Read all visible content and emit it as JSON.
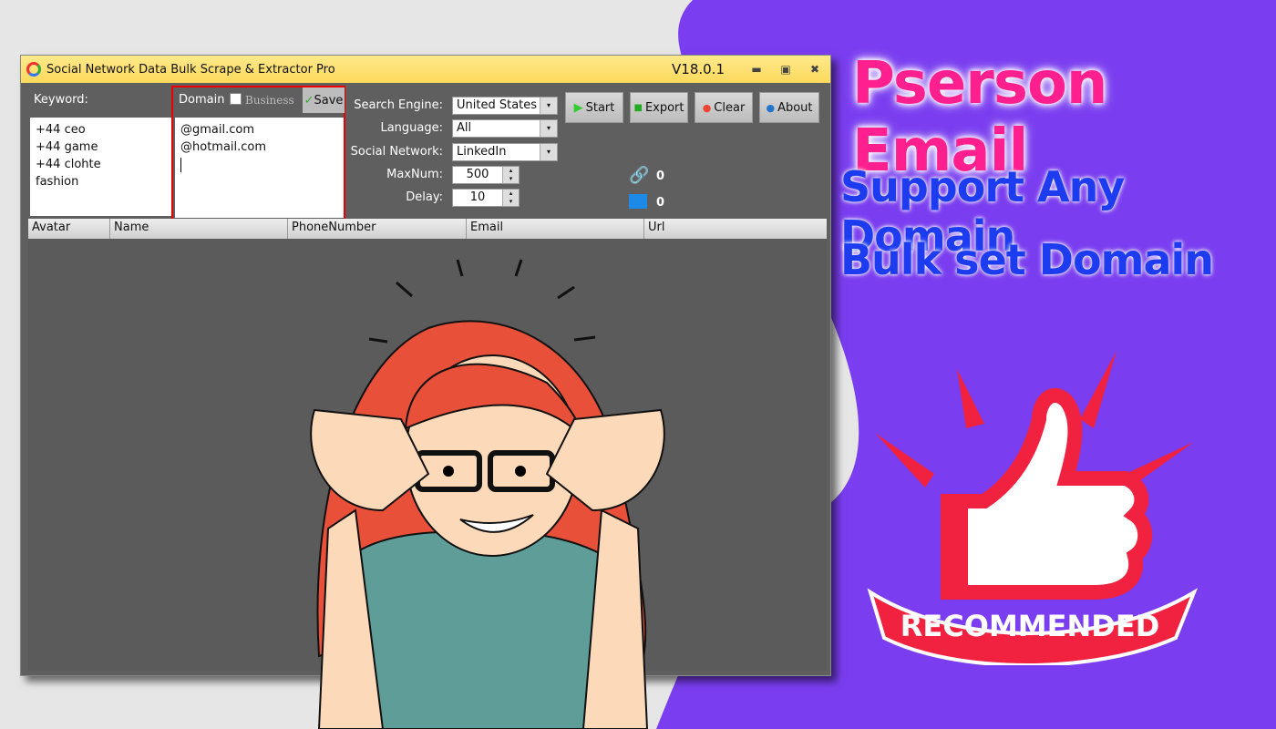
{
  "window": {
    "title": "Social Network Data Bulk Scrape & Extractor Pro",
    "version": "V18.0.1",
    "minimize": "▬",
    "restore": "▣",
    "close": "✖"
  },
  "keyword": {
    "label": "Keyword:",
    "lines": [
      "+44 ceo",
      "+44 game",
      "+44 clohte",
      "fashion"
    ]
  },
  "domain": {
    "label": "Domain",
    "business_label": "Business",
    "business_checked": false,
    "save_label": "Save",
    "lines": [
      "@gmail.com",
      "@hotmail.com"
    ]
  },
  "settings": {
    "search_engine": {
      "label": "Search Engine:",
      "value": "United States"
    },
    "language": {
      "label": "Language:",
      "value": "All"
    },
    "social_network": {
      "label": "Social Network:",
      "value": "LinkedIn"
    },
    "maxnum": {
      "label": "MaxNum:",
      "value": "500"
    },
    "delay": {
      "label": "Delay:",
      "value": "10"
    }
  },
  "buttons": {
    "start": "Start",
    "export": "Export",
    "clear": "Clear",
    "about": "About"
  },
  "counters": {
    "links": "0",
    "emails": "0"
  },
  "table": {
    "columns": [
      "Avatar",
      "Name",
      "PhoneNumber",
      "Email",
      "Url"
    ]
  },
  "promo": {
    "headline": "Pserson Email",
    "line1": "Support Any Domain",
    "line2": "Bulk set Domain",
    "badge": "RECOMMENDED"
  },
  "colors": {
    "purple": "#7a3ef0",
    "headline": "#ff1f8e",
    "blue_text": "#1d3cf0",
    "thumb_red": "#f0223f",
    "title_bar": "#fbe07a"
  }
}
